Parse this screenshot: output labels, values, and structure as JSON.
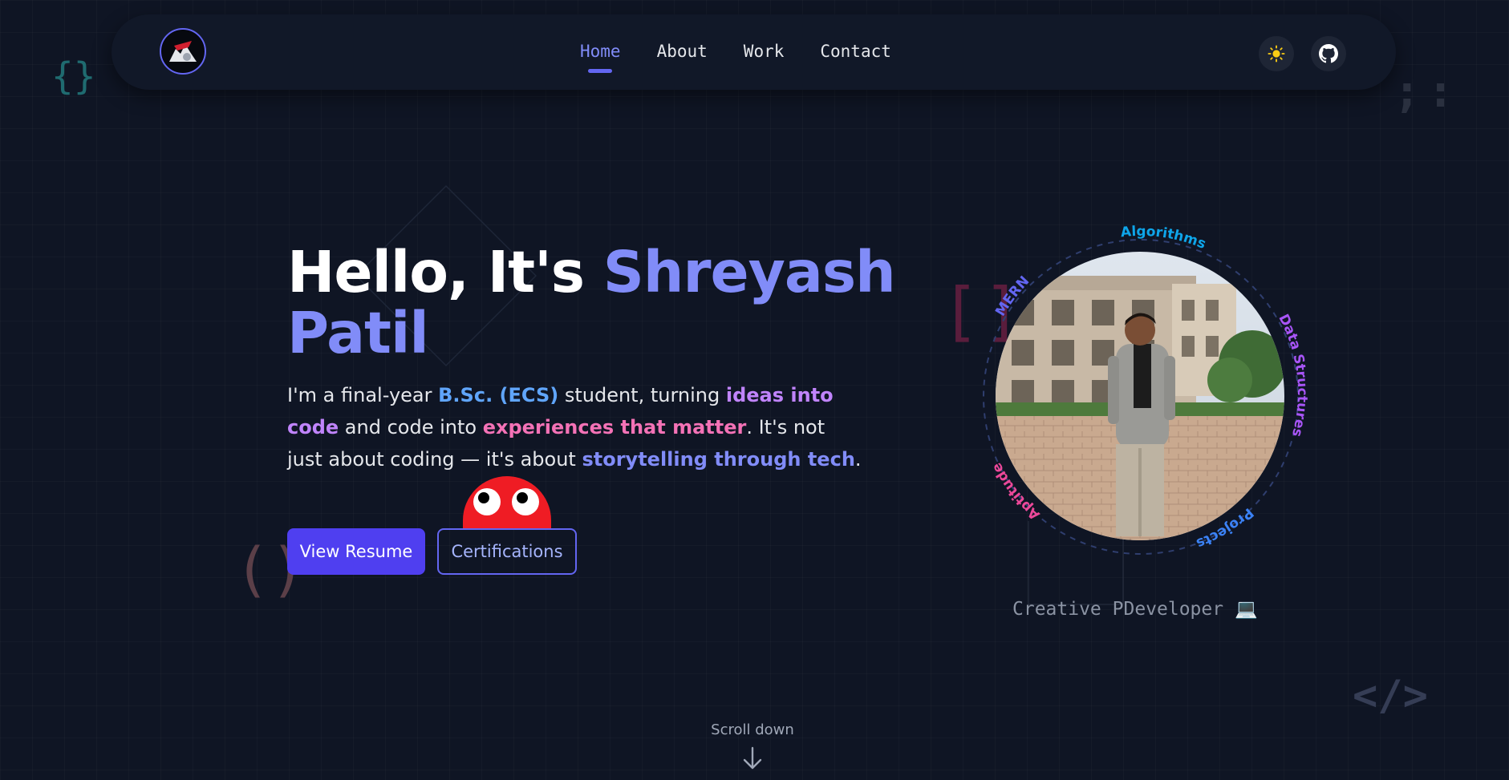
{
  "nav": {
    "links": [
      {
        "label": "Home",
        "active": true
      },
      {
        "label": "About",
        "active": false
      },
      {
        "label": "Work",
        "active": false
      },
      {
        "label": "Contact",
        "active": false
      }
    ],
    "theme_icon": "sun-icon",
    "github_icon": "github-icon"
  },
  "decor": {
    "braces": "{}",
    "colon": ";:",
    "brackets": "[]",
    "parens": "()",
    "tag": "</>"
  },
  "hero": {
    "title_part1": "Hello, It's ",
    "title_name_first": "Shreyash",
    "title_name_last": "Patil",
    "desc": {
      "t1": "I'm a final-year ",
      "h1": "B.Sc. (ECS)",
      "t2": " student, turning ",
      "h2": "ideas into code",
      "t3": " and code into ",
      "h3": "experiences that matter",
      "t4": ". It's not just about coding — it's about ",
      "h4": "storytelling through tech",
      "t5": "."
    },
    "primary_button": "View Resume",
    "secondary_button": "Certifications"
  },
  "profile": {
    "orbit_labels": {
      "top": "Algorithms",
      "left": "MERN",
      "right": "Data Structures",
      "bottom_left": "Aptitude",
      "bottom_right": "Projects"
    },
    "tagline": "Creative PDeveloper 💻"
  },
  "scroll": {
    "label": "Scroll down"
  },
  "colors": {
    "background": "#0f1524",
    "accent": "#6366f1",
    "accent_light": "#818cf8",
    "blue": "#60a5fa",
    "purple": "#c084fc",
    "pink": "#f472b6",
    "button": "#4f3ff0"
  }
}
